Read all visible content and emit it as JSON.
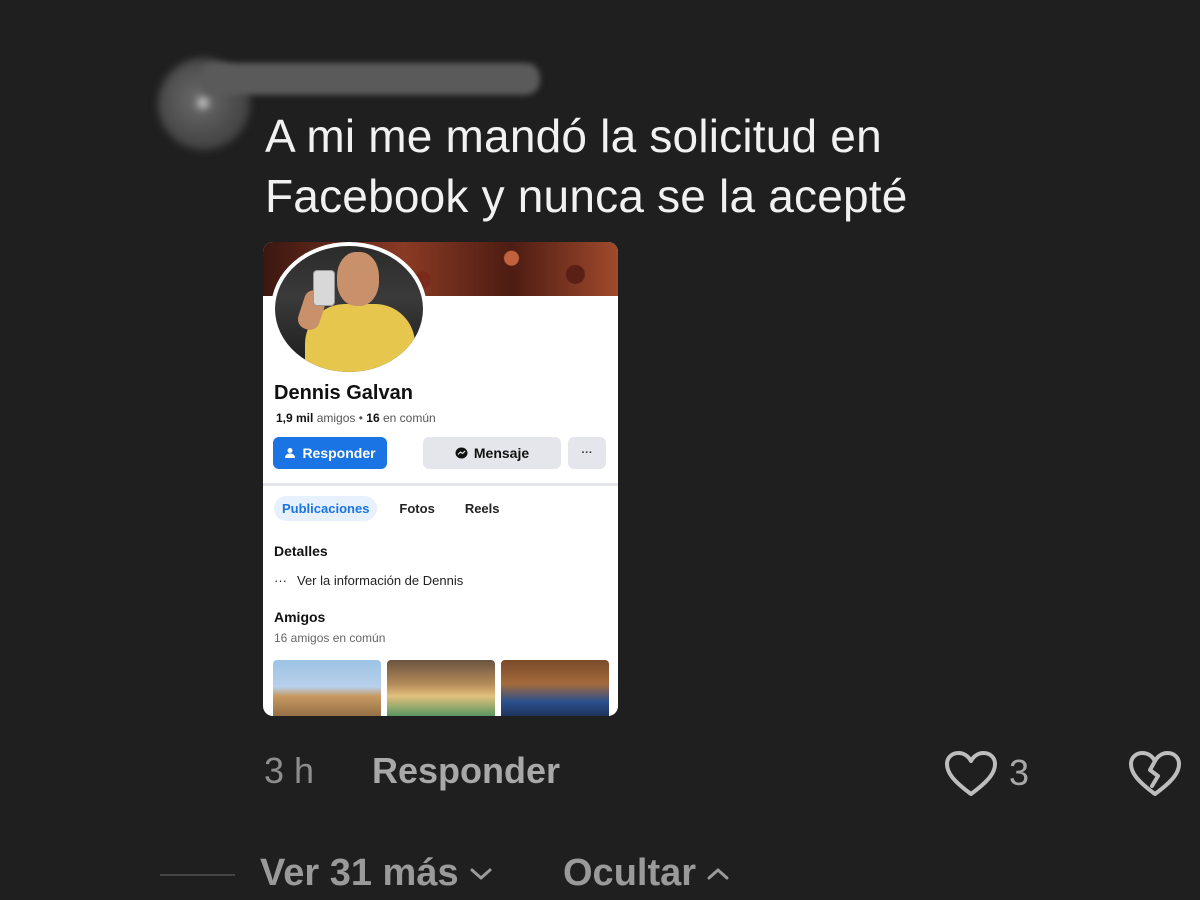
{
  "comment": {
    "text_line1": "A mi me mandó la solicitud en",
    "text_line2": "Facebook y nunca se la acepté",
    "time": "3 h",
    "reply_label": "Responder",
    "like_count": "3",
    "like_icon": "heart-outline-icon",
    "dislike_icon": "broken-heart-icon"
  },
  "facebook_profile": {
    "name": "Dennis Galvan",
    "friends_count": "1,9 mil",
    "friends_label": "amigos",
    "separator": "•",
    "mutual_count": "16",
    "mutual_label": "en común",
    "reply_button": "Responder",
    "message_button": "Mensaje",
    "more_button": "···",
    "tabs": [
      {
        "label": "Publicaciones",
        "active": true
      },
      {
        "label": "Fotos",
        "active": false
      },
      {
        "label": "Reels",
        "active": false
      }
    ],
    "details_title": "Detalles",
    "details_dots": "···",
    "details_link": "Ver la información de Dennis",
    "friends_title": "Amigos",
    "friends_subtitle": "16 amigos en común"
  },
  "thread": {
    "more_label": "Ver 31 más",
    "hide_label": "Ocultar"
  },
  "colors": {
    "background": "#1f1f20",
    "fb_blue": "#1b74e4",
    "text_muted": "#a8a8a8"
  }
}
